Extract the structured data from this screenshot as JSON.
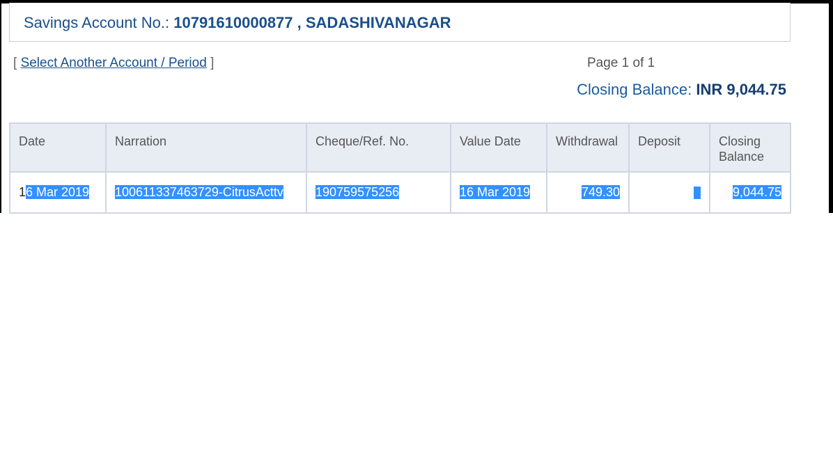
{
  "account": {
    "label": "Savings Account No.: ",
    "number": "10791610000877",
    "separator": " , ",
    "branch": "SADASHIVANAGAR"
  },
  "nav": {
    "bracket_open": "[ ",
    "select_link": "Select Another Account / Period",
    "bracket_close": " ]",
    "page_info": "Page 1 of 1"
  },
  "closing": {
    "label": "Closing Balance: ",
    "value": "INR 9,044.75"
  },
  "table": {
    "headers": [
      "Date",
      "Narration",
      "Cheque/Ref. No.",
      "Value Date",
      "Withdrawal",
      "Deposit",
      "Closing Balance"
    ],
    "rows": [
      {
        "date_first": "1",
        "date_rest": "6 Mar 2019",
        "narration": "100611337463729-CitrusActtv",
        "cheque_ref": "190759575256",
        "value_date": "16 Mar 2019",
        "withdrawal": "749.30",
        "deposit": "",
        "closing_balance": "9,044.75"
      }
    ]
  },
  "colors": {
    "brand_blue": "#1a4f8b",
    "header_bg": "#e8ecf3",
    "selection": "#3390ff"
  }
}
